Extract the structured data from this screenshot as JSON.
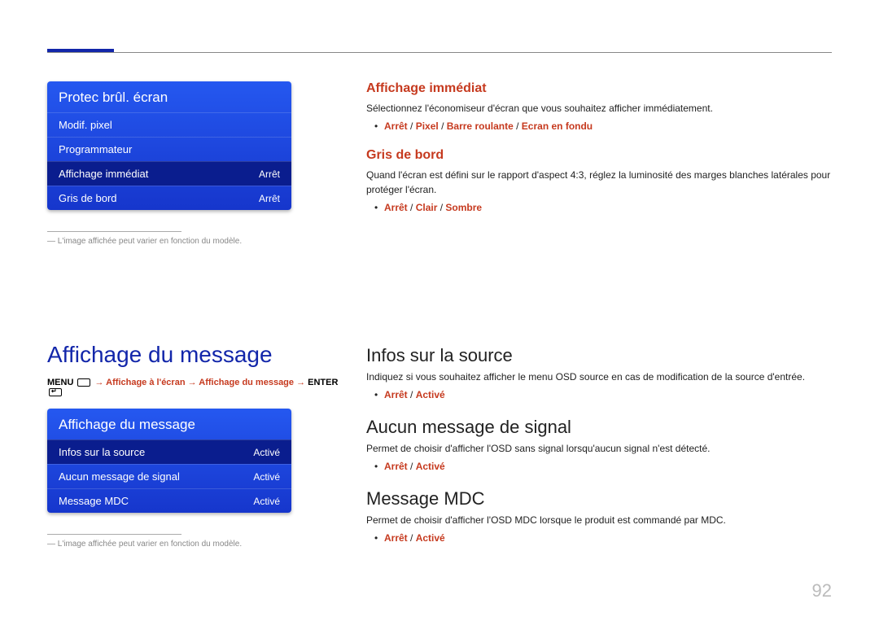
{
  "page_number": "92",
  "top_section": {
    "menu1": {
      "title": "Protec brûl. écran",
      "rows": [
        {
          "label": "Modif. pixel",
          "value": ""
        },
        {
          "label": "Programmateur",
          "value": ""
        },
        {
          "label": "Affichage immédiat",
          "value": "Arrêt",
          "selected": true
        },
        {
          "label": "Gris de bord",
          "value": "Arrêt"
        }
      ]
    },
    "footnote1": "L'image affichée peut varier en fonction du modèle.",
    "right": {
      "immediate": {
        "heading": "Affichage immédiat",
        "desc": "Sélectionnez l'économiseur d'écran que vous souhaitez afficher immédiatement.",
        "options": [
          "Arrêt",
          "Pixel",
          "Barre roulante",
          "Ecran en fondu"
        ]
      },
      "gray": {
        "heading": "Gris de bord",
        "desc": "Quand l'écran est défini sur le rapport d'aspect 4:3, réglez la luminosité des marges blanches latérales pour protéger l'écran.",
        "options": [
          "Arrêt",
          "Clair",
          "Sombre"
        ]
      }
    }
  },
  "bottom_section": {
    "title": "Affichage du message",
    "breadcrumb": {
      "parts": [
        "MENU",
        " → ",
        "Affichage à l'écran",
        " → ",
        "Affichage du message",
        " → ",
        "ENTER"
      ]
    },
    "menu2": {
      "title": "Affichage du message",
      "rows": [
        {
          "label": "Infos sur la source",
          "value": "Activé",
          "selected": true
        },
        {
          "label": "Aucun message de signal",
          "value": "Activé"
        },
        {
          "label": "Message MDC",
          "value": "Activé"
        }
      ]
    },
    "footnote2": "L'image affichée peut varier en fonction du modèle.",
    "right": {
      "source": {
        "heading": "Infos sur la source",
        "desc": "Indiquez si vous souhaitez afficher le menu OSD source en cas de modification de la source d'entrée.",
        "options": [
          "Arrêt",
          "Activé"
        ]
      },
      "nosignal": {
        "heading": "Aucun message de signal",
        "desc": "Permet de choisir d'afficher l'OSD sans signal lorsqu'aucun signal n'est détecté.",
        "options": [
          "Arrêt",
          "Activé"
        ]
      },
      "mdc": {
        "heading": "Message MDC",
        "desc": "Permet de choisir d'afficher l'OSD MDC lorsque le produit est commandé par MDC.",
        "options": [
          "Arrêt",
          "Activé"
        ]
      }
    }
  }
}
